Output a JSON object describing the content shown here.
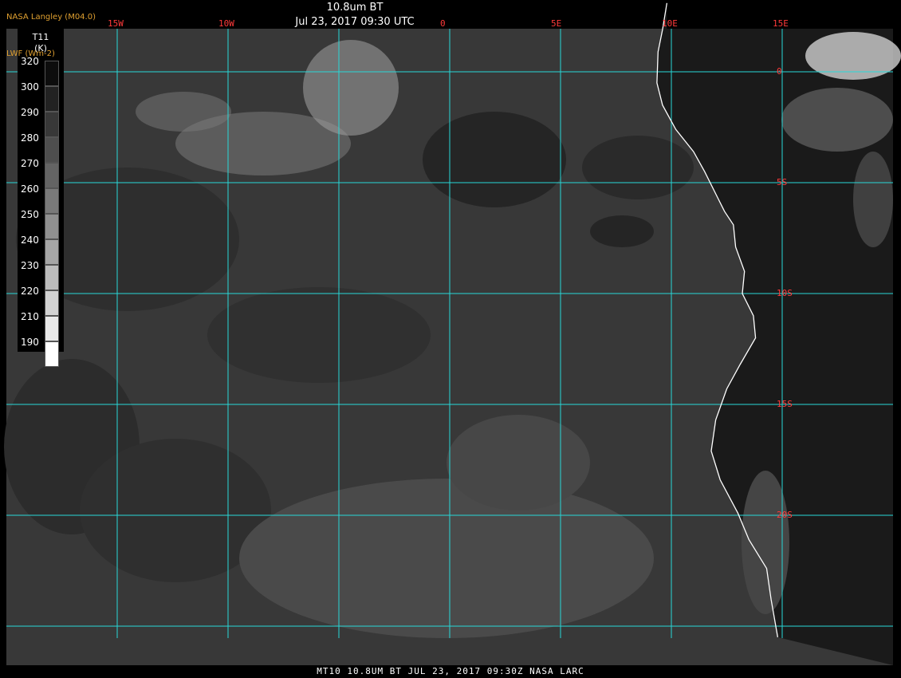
{
  "header": {
    "title": "10.8um BT",
    "subtitle": "Jul 23, 2017 09:30 UTC",
    "producer": "NASA Langley (M04.0)",
    "product": "LWF (Wm-2)"
  },
  "footer": "MT10   10.8UM BT   JUL 23, 2017 09:30Z   NASA LARC",
  "colorbar": {
    "label_line1": "T11",
    "label_line2": "(K)",
    "ticks": [
      "320",
      "300",
      "290",
      "280",
      "270",
      "260",
      "250",
      "240",
      "230",
      "220",
      "210",
      "190"
    ],
    "shades": [
      "#0d0d0d",
      "#222222",
      "#383838",
      "#4e4e4e",
      "#646464",
      "#7a7a7a",
      "#909090",
      "#a6a6a6",
      "#bcbcbc",
      "#d2d2d2",
      "#e8e8e8",
      "#ffffff"
    ]
  },
  "grid": {
    "color": "#28d8d8",
    "lon_labels": [
      {
        "lon": -15,
        "text": "15W"
      },
      {
        "lon": -10,
        "text": "10W"
      },
      {
        "lon": 0,
        "text": "0"
      },
      {
        "lon": 5,
        "text": "5E"
      },
      {
        "lon": 10,
        "text": "10E"
      },
      {
        "lon": 15,
        "text": "15E"
      }
    ],
    "lat_labels": [
      {
        "lat": 0,
        "text": "0"
      },
      {
        "lat": -5,
        "text": "5S"
      },
      {
        "lat": -10,
        "text": "10S"
      },
      {
        "lat": -15,
        "text": "15S"
      },
      {
        "lat": -20,
        "text": "20S"
      }
    ]
  },
  "coastline": [
    [
      9.8,
      3.1
    ],
    [
      9.6,
      1.9
    ],
    [
      9.4,
      0.9
    ],
    [
      9.35,
      -0.5
    ],
    [
      9.6,
      -1.5
    ],
    [
      10.2,
      -2.6
    ],
    [
      11.0,
      -3.6
    ],
    [
      11.5,
      -4.5
    ],
    [
      12.1,
      -5.7
    ],
    [
      12.4,
      -6.3
    ],
    [
      12.8,
      -6.9
    ],
    [
      12.9,
      -7.9
    ],
    [
      13.3,
      -9.0
    ],
    [
      13.2,
      -10.0
    ],
    [
      13.7,
      -11.0
    ],
    [
      13.8,
      -12.0
    ],
    [
      13.1,
      -13.2
    ],
    [
      12.5,
      -14.3
    ],
    [
      12.0,
      -15.7
    ],
    [
      11.8,
      -17.1
    ],
    [
      12.2,
      -18.4
    ],
    [
      13.0,
      -19.9
    ],
    [
      13.5,
      -21.1
    ],
    [
      14.3,
      -22.4
    ],
    [
      14.5,
      -23.8
    ],
    [
      14.8,
      -25.5
    ]
  ],
  "regions": {
    "ocean_tone": "#383838",
    "land_tone": "#1a1a1a",
    "cloud_tone": "#c8c8c8",
    "stratus_tone": "#4c4c4c"
  }
}
